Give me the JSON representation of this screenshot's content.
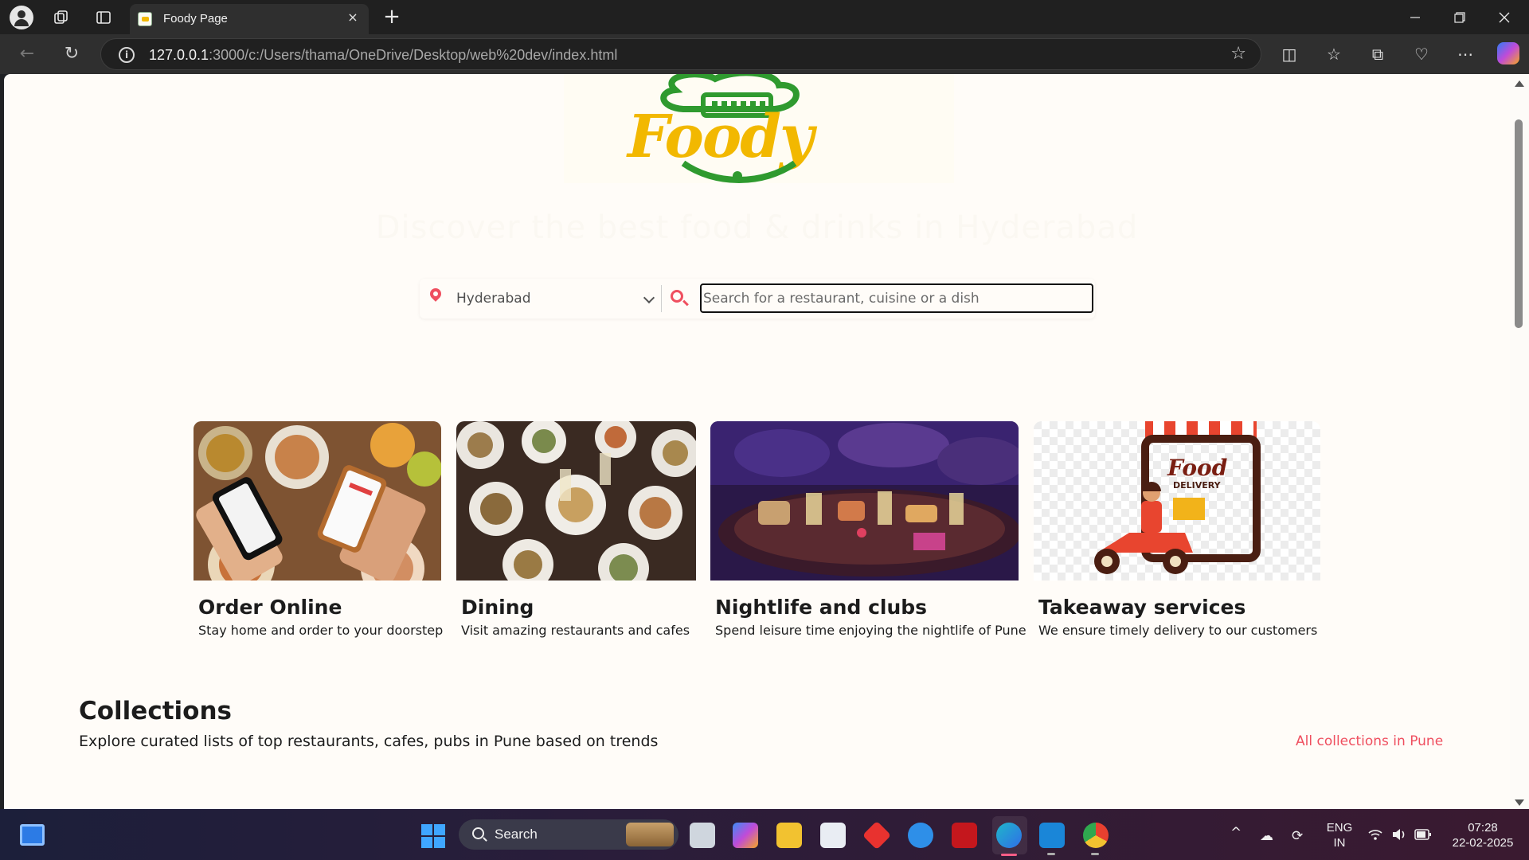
{
  "browser": {
    "tab_title": "Foody Page",
    "tab_close": "×",
    "new_tab": "+",
    "url_host": "127.0.0.1",
    "url_rest": ":3000/c:/Users/thama/OneDrive/Desktop/web%20dev/index.html",
    "info_glyph": "i",
    "star_glyph": "☆",
    "back_glyph": "←",
    "reload_glyph": "↻",
    "minimize_glyph": "—",
    "restore_glyph": "❐",
    "close_glyph": "✕",
    "tool_glyphs": {
      "split": "◫",
      "favorites": "☆",
      "collections": "⧉",
      "health": "♡",
      "more": "⋯"
    }
  },
  "page": {
    "hero_title": "Discover the best food & drinks in Hyderabad",
    "location": "Hyderabad",
    "search_placeholder": "Search for a restaurant, cuisine or a dish",
    "cards": [
      {
        "title": "Order Online",
        "desc": "Stay home and order to your doorstep"
      },
      {
        "title": "Dining",
        "desc": "Visit amazing restaurants and cafes"
      },
      {
        "title": "Nightlife and clubs",
        "desc": "Spend leisure time enjoying the nightlife of Pune"
      },
      {
        "title": "Takeaway services",
        "desc": "We ensure timely delivery to our customers"
      }
    ],
    "collections_title": "Collections",
    "collections_desc": "Explore curated lists of top restaurants, cafes, pubs in Pune based on trends",
    "collections_link": "All collections in Pune"
  },
  "taskbar": {
    "search_label": "Search",
    "lang_line1": "ENG",
    "lang_line2": "IN",
    "time": "07:28",
    "date": "22-02-2025",
    "chevron_up": "^"
  },
  "colors": {
    "accent_red": "#ef4f5f",
    "logo_yellow": "#f2b800",
    "logo_green": "#2f9a2f",
    "page_bg": "#fffcf8"
  }
}
